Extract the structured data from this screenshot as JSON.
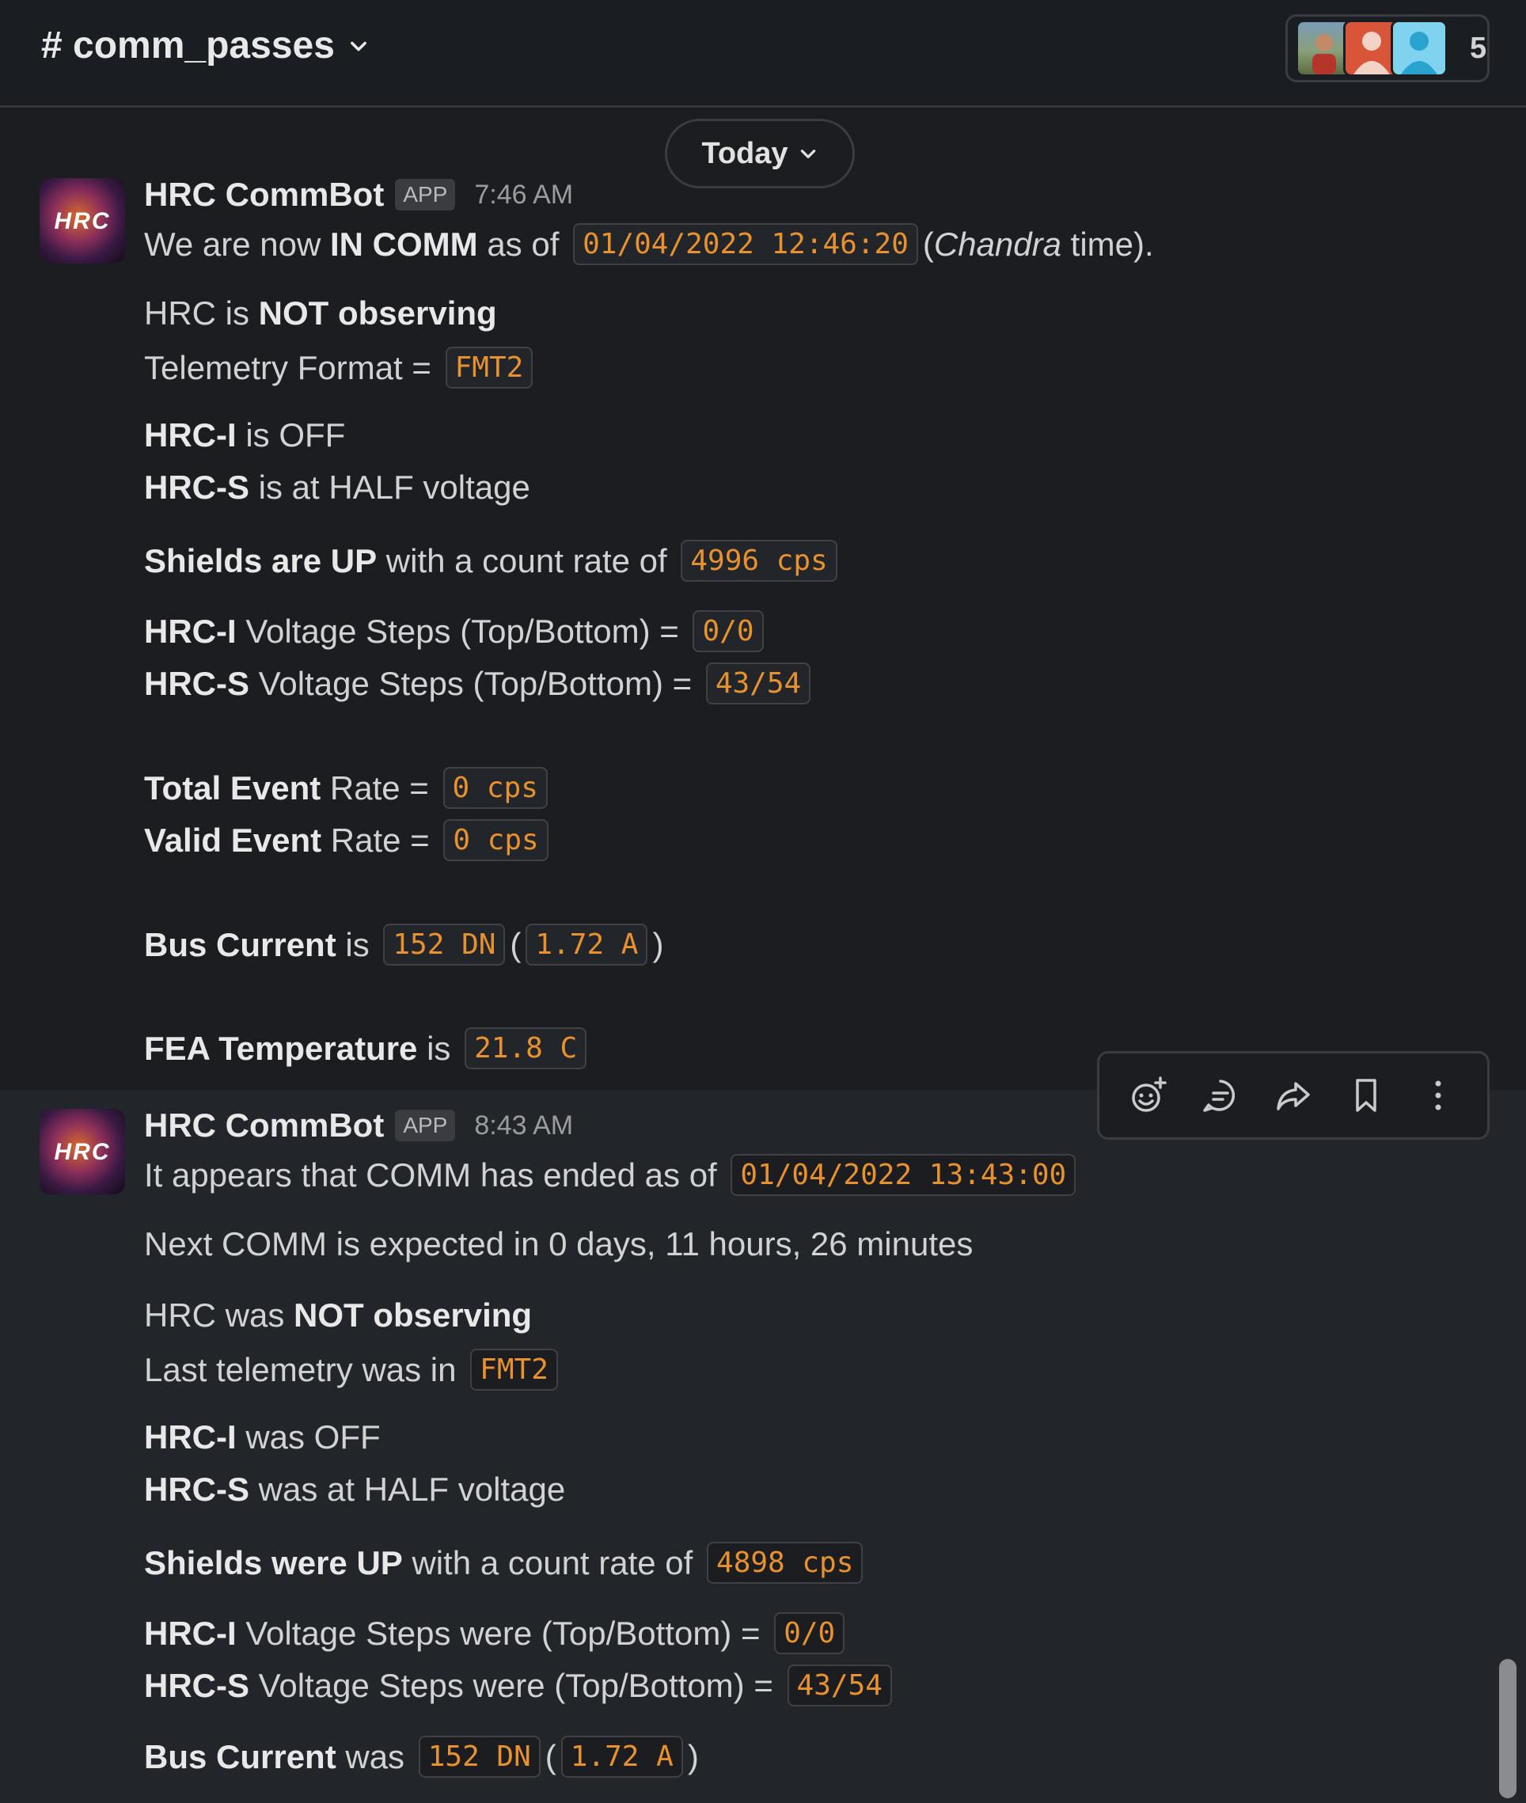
{
  "header": {
    "channel": "# comm_passes",
    "member_count": "5"
  },
  "date_divider": {
    "label": "Today"
  },
  "messages": [
    {
      "sender": "HRC CommBot",
      "badge": "APP",
      "time": "7:46 AM",
      "avatar_text": "HRC",
      "l1": {
        "a": "We are now ",
        "b": "IN COMM",
        "c": " as of ",
        "code": "01/04/2022 12:46:20",
        "d": "(",
        "e": "Chandra",
        "f": " time)."
      },
      "l2": {
        "a": "HRC is ",
        "b": "NOT observing"
      },
      "l3": {
        "a": "Telemetry Format = ",
        "code": "FMT2"
      },
      "l4": {
        "b": "HRC-I",
        "a": " is OFF"
      },
      "l5": {
        "b": "HRC-S",
        "a": " is at HALF voltage"
      },
      "l6": {
        "b": "Shields are UP",
        "a": " with a count rate of ",
        "code": "4996 cps"
      },
      "l7": {
        "b": "HRC-I",
        "a": " Voltage Steps (Top/Bottom) = ",
        "code": "0/0"
      },
      "l8": {
        "b": "HRC-S",
        "a": " Voltage Steps (Top/Bottom) = ",
        "code": "43/54"
      },
      "l9": {
        "b": "Total Event",
        "a": " Rate = ",
        "code": "0 cps"
      },
      "l10": {
        "b": "Valid Event",
        "a": " Rate = ",
        "code": "0 cps"
      },
      "l11": {
        "b": "Bus Current",
        "a": " is ",
        "code1": "152 DN",
        "p1": "(",
        "code2": "1.72 A",
        "p2": ")"
      },
      "l12": {
        "b": "FEA Temperature",
        "a": " is ",
        "code": "21.8 C"
      }
    },
    {
      "sender": "HRC CommBot",
      "badge": "APP",
      "time": "8:43 AM",
      "avatar_text": "HRC",
      "l1": {
        "a": "It appears that COMM has ended as of ",
        "code": "01/04/2022 13:43:00"
      },
      "l2": {
        "a": "Next COMM is expected in 0 days, 11 hours, 26 minutes"
      },
      "l3": {
        "a": "HRC was ",
        "b": "NOT observing"
      },
      "l4": {
        "a": "Last telemetry was in ",
        "code": "FMT2"
      },
      "l5": {
        "b": "HRC-I",
        "a": " was OFF"
      },
      "l6": {
        "b": "HRC-S",
        "a": " was at HALF voltage"
      },
      "l7": {
        "b": "Shields were UP",
        "a": " with a count rate of ",
        "code": "4898 cps"
      },
      "l8": {
        "b": "HRC-I",
        "a": " Voltage Steps were (Top/Bottom) = ",
        "code": "0/0"
      },
      "l9": {
        "b": "HRC-S",
        "a": " Voltage Steps were (Top/Bottom) = ",
        "code": "43/54"
      },
      "l10": {
        "b": "Bus Current",
        "a": " was ",
        "code1": "152 DN",
        "p1": "(",
        "code2": "1.72 A",
        "p2": ")"
      }
    }
  ],
  "toolbar": {
    "icons": [
      "add-reaction-icon",
      "reply-in-thread-icon",
      "forward-icon",
      "bookmark-icon",
      "more-actions-icon"
    ]
  }
}
